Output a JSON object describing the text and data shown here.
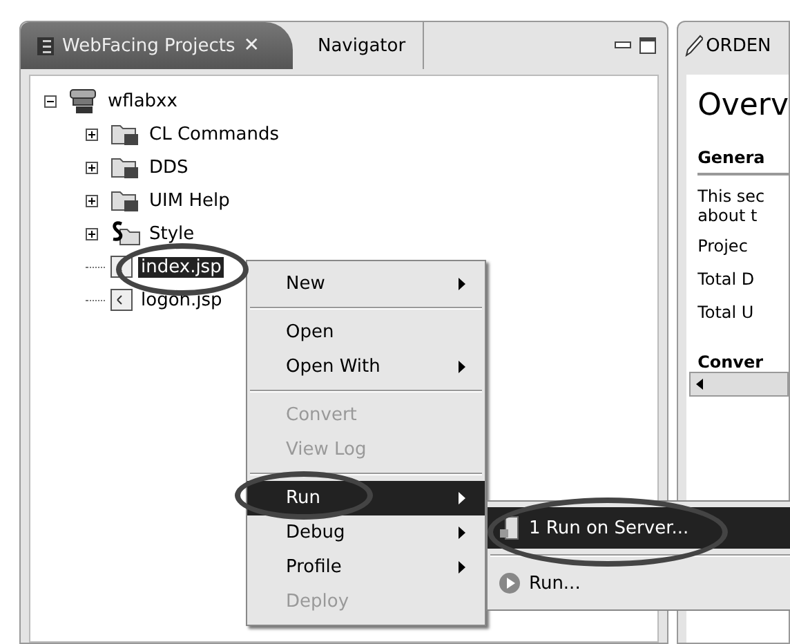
{
  "left_panel": {
    "tabs": [
      {
        "label": "WebFacing Projects",
        "selected": true,
        "close": "✕"
      },
      {
        "label": "Navigator",
        "selected": false
      }
    ],
    "tree": [
      {
        "label": "wflabxx",
        "kind": "project",
        "expanded": true,
        "selected": false,
        "children": [
          {
            "label": "CL Commands",
            "kind": "folder",
            "expanded": false,
            "selected": false
          },
          {
            "label": "DDS",
            "kind": "folder",
            "expanded": false,
            "selected": false
          },
          {
            "label": "UIM Help",
            "kind": "folder",
            "expanded": false,
            "selected": false
          },
          {
            "label": "Style",
            "kind": "style",
            "expanded": false,
            "selected": false
          },
          {
            "label": "index.jsp",
            "kind": "file",
            "selected": true
          },
          {
            "label": "logon.jsp",
            "kind": "file",
            "selected": false
          }
        ]
      }
    ]
  },
  "editor": {
    "tab": "ORDEN",
    "heading": "Overv",
    "section": "Genera",
    "description": [
      "This sec",
      "about t"
    ],
    "fields": [
      "Projec",
      "Total D",
      "Total U"
    ],
    "section_2": "Conver"
  },
  "context_menu": [
    {
      "label": "New",
      "kind": "item",
      "submenu": true,
      "disabled": false,
      "selected": false
    },
    {
      "kind": "separator"
    },
    {
      "label": "Open",
      "kind": "item",
      "submenu": false,
      "disabled": false,
      "selected": false
    },
    {
      "label": "Open With",
      "kind": "item",
      "submenu": true,
      "disabled": false,
      "selected": false
    },
    {
      "kind": "separator"
    },
    {
      "label": "Convert",
      "kind": "item",
      "submenu": false,
      "disabled": true,
      "selected": false
    },
    {
      "label": "View Log",
      "kind": "item",
      "submenu": false,
      "disabled": true,
      "selected": false
    },
    {
      "kind": "separator"
    },
    {
      "label": "Run",
      "kind": "item",
      "submenu": true,
      "disabled": false,
      "selected": true
    },
    {
      "label": "Debug",
      "kind": "item",
      "submenu": true,
      "disabled": false,
      "selected": false
    },
    {
      "label": "Profile",
      "kind": "item",
      "submenu": true,
      "disabled": false,
      "selected": false
    },
    {
      "label": "Deploy",
      "kind": "item",
      "submenu": false,
      "disabled": true,
      "selected": false
    }
  ],
  "submenu": [
    {
      "label": "1 Run on Server...",
      "kind": "server",
      "selected": true
    },
    {
      "kind": "separator"
    },
    {
      "label": "Run...",
      "kind": "run",
      "selected": false
    }
  ]
}
